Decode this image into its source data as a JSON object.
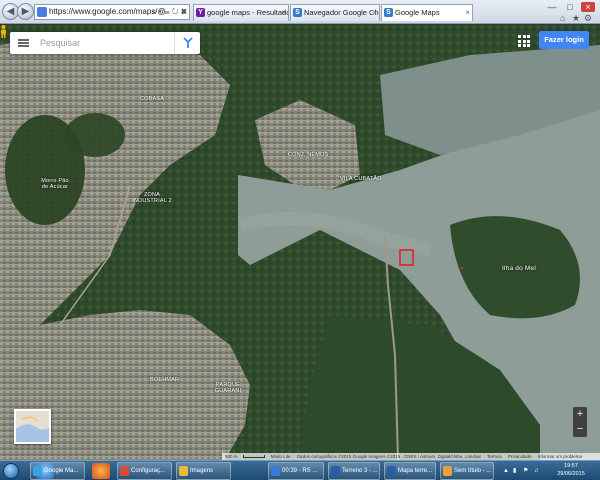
{
  "browser": {
    "address": "https://www.google.com/maps/@",
    "address_tools": "⌕ • ☰ ↻ ✖",
    "tabs": [
      {
        "label": "google maps - Resultados da b...",
        "icon": "yahoo-icon",
        "color": "#6b1fa6",
        "glyph": "Y"
      },
      {
        "label": "Navegador Google Chrome",
        "icon": "bing-icon",
        "color": "#2f7cc8",
        "glyph": "S"
      },
      {
        "label": "Google Maps",
        "icon": "maps-icon",
        "color": "#2f7cc8",
        "glyph": "S"
      }
    ],
    "toolbar_icons": [
      "home-icon",
      "star-icon",
      "gear-icon"
    ]
  },
  "map": {
    "search_placeholder": "Pesquisar",
    "login_label": "Fazer login",
    "zoom_in": "+",
    "zoom_out": "−",
    "places": [
      {
        "name": "COBASA",
        "key": "p1"
      },
      {
        "name": "CONJ. NEMOS",
        "key": "p2"
      },
      {
        "name": "VILA CUBATÃO",
        "key": "p3"
      },
      {
        "name": "Morro Pão de Acúcar",
        "key": "p4"
      },
      {
        "name": "ZONA INDUSTRIAL 2",
        "key": "p5"
      },
      {
        "name": "Ilha do Mel",
        "key": "p6"
      },
      {
        "name": "BOEHMAR",
        "key": "p7"
      },
      {
        "name": "PARQUE GUARANI",
        "key": "p8"
      }
    ],
    "footer": {
      "scale": "500 m",
      "items": [
        "Modo Lite",
        "Dados cartográficos ©2015 Google Imagens ©2015 , CNES / Astrium, DigitalGlobe, Landsat",
        "Termos",
        "Privacidade",
        "Informar um problema"
      ]
    },
    "colors": {
      "marker": "#e8202a",
      "water": "#8d9a96",
      "forest": "#2f4a2b",
      "urban": "#8a8a7c"
    }
  },
  "taskbar": {
    "pinned": [
      "ie-icon",
      "firefox-icon",
      "chrome-icon"
    ],
    "buttons": [
      {
        "label": "Google Ma...",
        "icon": "ie-icon",
        "color": "#3aa0e8"
      },
      {
        "label": "Configuraç...",
        "icon": "chrome-icon",
        "color": "#d84a3a"
      },
      {
        "label": "Imagens",
        "icon": "folder-icon",
        "color": "#e7b93c"
      },
      {
        "label": "00:39 - RS ...",
        "icon": "media-icon",
        "color": "#3a7bd5"
      },
      {
        "label": "Terreno 3 - ...",
        "icon": "word-icon",
        "color": "#2b5faa"
      },
      {
        "label": "Mapa terre...",
        "icon": "word-icon",
        "color": "#2b5faa"
      },
      {
        "label": "Sem título - ...",
        "icon": "paint-icon",
        "color": "#e9a23b"
      }
    ],
    "time": "19:57",
    "date": "29/06/2015"
  }
}
